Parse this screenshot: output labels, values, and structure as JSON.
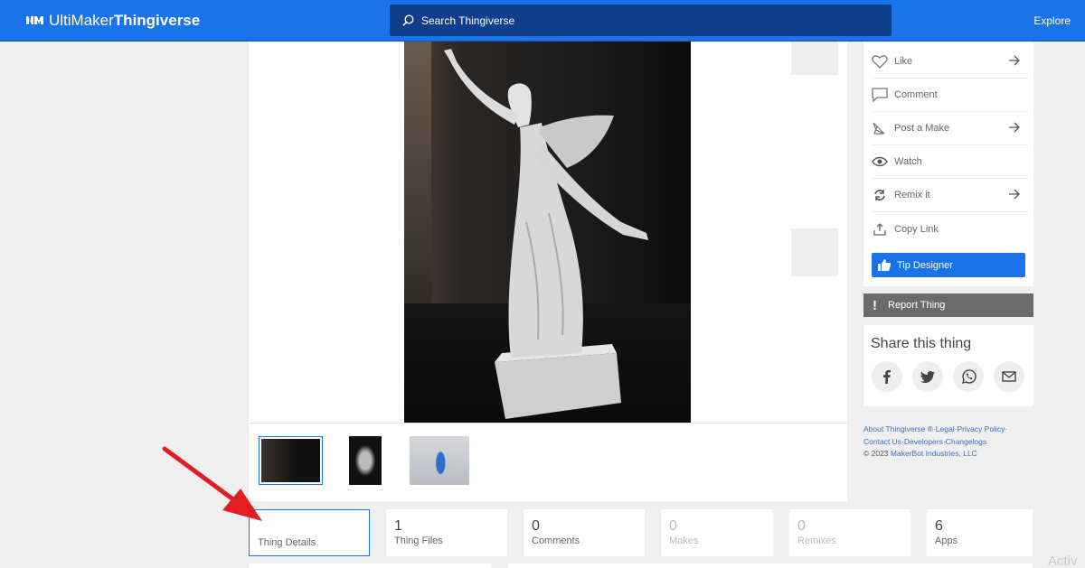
{
  "header": {
    "brand_prefix": "UltiMaker",
    "brand_name": "Thingiverse",
    "search_placeholder": "Search Thingiverse",
    "explore_label": "Explore",
    "search_icon": "search-icon",
    "logo_icon": "ultimaker-logo-icon"
  },
  "actions": [
    {
      "label": "Like",
      "icon": "heart-icon",
      "arrow": true
    },
    {
      "label": "Comment",
      "icon": "speech-bubble-icon",
      "arrow": false
    },
    {
      "label": "Post a Make",
      "icon": "make-pencil-icon",
      "arrow": true
    },
    {
      "label": "Watch",
      "icon": "eye-icon",
      "arrow": false
    },
    {
      "label": "Remix it",
      "icon": "remix-icon",
      "arrow": true
    },
    {
      "label": "Copy Link",
      "icon": "share-upload-icon",
      "arrow": false
    }
  ],
  "tip_designer_label": "Tip Designer",
  "report_label": "Report Thing",
  "share": {
    "title": "Share this thing",
    "buttons": [
      "facebook-icon",
      "twitter-icon",
      "whatsapp-icon",
      "email-icon"
    ]
  },
  "footer": {
    "line1": "About Thingiverse ®·Legal·Privacy Policy·",
    "line2": "Contact Us·Developers·Changelogs",
    "copyright": "© 2023",
    "company": "MakerBot Industries, LLC"
  },
  "stats": [
    {
      "num": "",
      "label": "Thing Details",
      "selected": true
    },
    {
      "num": "1",
      "label": "Thing Files"
    },
    {
      "num": "0",
      "label": "Comments"
    },
    {
      "num": "0",
      "label": "Makes",
      "dim": true
    },
    {
      "num": "0",
      "label": "Remixes",
      "dim": true
    },
    {
      "num": "6",
      "label": "Apps"
    }
  ],
  "watermark": "Activ",
  "colors": {
    "accent": "#1a73e8",
    "search_bg": "#0f3f8c",
    "report_bg": "#6b6b6b",
    "annotation_arrow": "#e02020"
  }
}
